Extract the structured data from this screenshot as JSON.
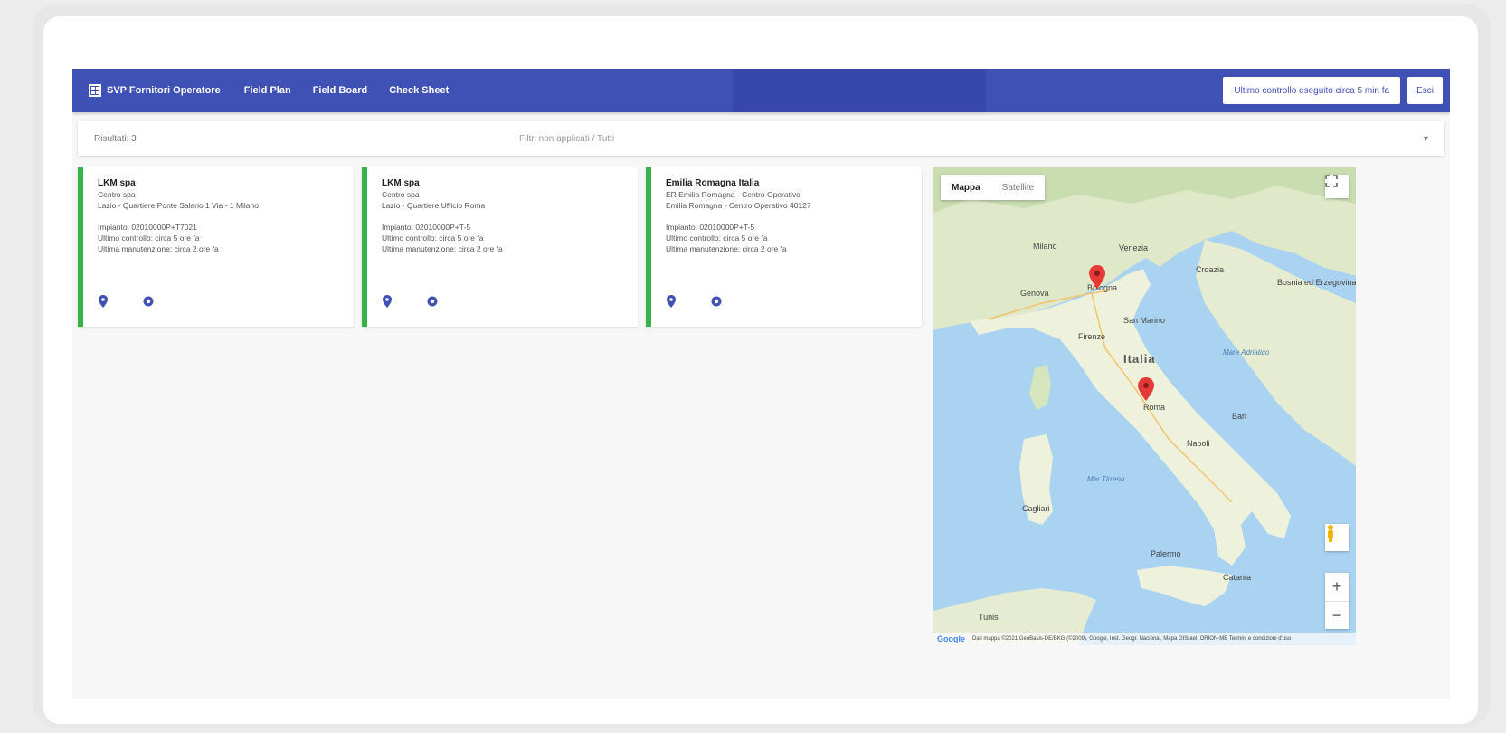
{
  "topbar": {
    "brand": "SVP Fornitori Operatore",
    "nav": [
      "Field Plan",
      "Field Board",
      "Check Sheet"
    ],
    "primary_button": "Ultimo controllo eseguito circa 5 min fa",
    "exit_button": "Esci"
  },
  "filters": {
    "count_label": "Risultati: 3",
    "filter_placeholder": "Filtri non applicati / Tutti"
  },
  "cards": [
    {
      "title": "LKM spa",
      "subtitle": "Centro spa",
      "address": "Lazio - Quartiere Ponte Salario 1 Via - 1 Milano",
      "code": "Impianto: 02010000P+T7021",
      "line1": "Ultimo controllo: circa 5 ore fa",
      "line2": "Ultima manutenzione: circa 2 ore fa"
    },
    {
      "title": "LKM spa",
      "subtitle": "Centro spa",
      "address": "Lazio - Quartiere Ufficio Roma",
      "code": "Impianto: 02010000P+T-5",
      "line1": "Ultimo controllo: circa 5 ore fa",
      "line2": "Ultima manutenzione: circa 2 ore fa"
    },
    {
      "title": "Emilia Romagna Italia",
      "subtitle": "ER Emilia Romagna - Centro Operativo",
      "address": "Emilia Romagna - Centro Operativo 40127",
      "code": "Impianto: 02010000P+T-5",
      "line1": "Ultimo controllo: circa 5 ore fa",
      "line2": "Ultima manutenzione: circa 2 ore fa"
    }
  ],
  "map": {
    "type_map": "Mappa",
    "type_satellite": "Satellite",
    "zoom_in": "+",
    "zoom_out": "−",
    "google": "Google",
    "attribution": "Dati mappa ©2021 GeoBasis-DE/BKG (©2009), Google, Inst. Geogr. Nacional, Mapa GISrael, ORION-ME   Termini e condizioni d'uso",
    "labels": {
      "italia": "Italia",
      "milano": "Milano",
      "venezia": "Venezia",
      "bologna": "Bologna",
      "genova": "Genova",
      "firenze": "Firenze",
      "san_marino": "San Marino",
      "roma": "Roma",
      "napoli": "Napoli",
      "bari": "Bari",
      "palermo": "Palermo",
      "catania": "Catania",
      "cagliari": "Cagliari",
      "croazia": "Croazia",
      "bosnia": "Bosnia ed Erzegovina",
      "tunisi": "Tunisi",
      "mar_tirreno": "Mar Tirreno",
      "mare_adriatico": "Mare Adriatico"
    },
    "pin_color": "#e53935"
  },
  "colors": {
    "primary": "#3f51b5",
    "accent_green": "#36b34a"
  }
}
